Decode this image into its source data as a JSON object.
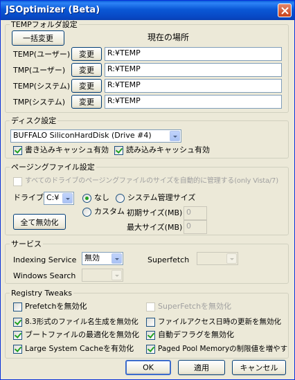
{
  "window": {
    "title": "JSOptimizer (Beta)"
  },
  "temp": {
    "group_label": "TEMPフォルダ設定",
    "bulk_change_label": "一括変更",
    "current_location_header": "現在の場所",
    "change_label": "変更",
    "rows": [
      {
        "label": "TEMP(ユーザー)",
        "value": "R:¥TEMP"
      },
      {
        "label": "TMP(ユーザー)",
        "value": "R:¥TEMP"
      },
      {
        "label": "TEMP(システム)",
        "value": "R:¥TEMP"
      },
      {
        "label": "TMP(システム)",
        "value": "R:¥TEMP"
      }
    ]
  },
  "disk": {
    "group_label": "ディスク設定",
    "selected_disk": "BUFFALO SiliconHardDisk (Drive #4)",
    "write_cache_label": "書き込みキャッシュ有効",
    "write_cache_checked": true,
    "read_cache_label": "読み込みキャッシュ有効",
    "read_cache_checked": true
  },
  "paging": {
    "group_label": "ページングファイル設定",
    "auto_manage_label": "すべてのドライブのページングファイルのサイズを自動的に管理する(only Vista/7)",
    "auto_manage_checked": false,
    "drive_label": "ドライブ:",
    "drive_value": "C:¥",
    "none_label": "なし",
    "none_selected": true,
    "system_managed_label": "システム管理サイズ",
    "custom_label": "カスタム",
    "initial_size_label": "初期サイズ(MB)",
    "initial_size_value": "0",
    "max_size_label": "最大サイズ(MB)",
    "max_size_value": "0",
    "disable_all_label": "全て無効化"
  },
  "services": {
    "group_label": "サービス",
    "indexing_label": "Indexing Service",
    "indexing_value": "無効",
    "superfetch_label": "Superfetch",
    "superfetch_value": "",
    "windows_search_label": "Windows Search",
    "windows_search_value": ""
  },
  "tweaks": {
    "group_label": "Registry Tweaks",
    "prefetch_label": "Prefetchを無効化",
    "superfetch_disable_label": "SuperFetchを無効化",
    "short_name_label": "8.3形式のファイル名生成を無効化",
    "last_access_label": "ファイルアクセス日時の更新を無効化",
    "boot_opt_label": "ブートファイルの最適化を無効化",
    "auto_defrag_label": "自動デフラグを無効化",
    "large_cache_label": "Large System Cacheを有効化",
    "paged_pool_label": "Paged Pool Memoryの制限値を増やす"
  },
  "footer": {
    "ok_label": "OK",
    "apply_label": "適用",
    "cancel_label": "キャンセル"
  }
}
